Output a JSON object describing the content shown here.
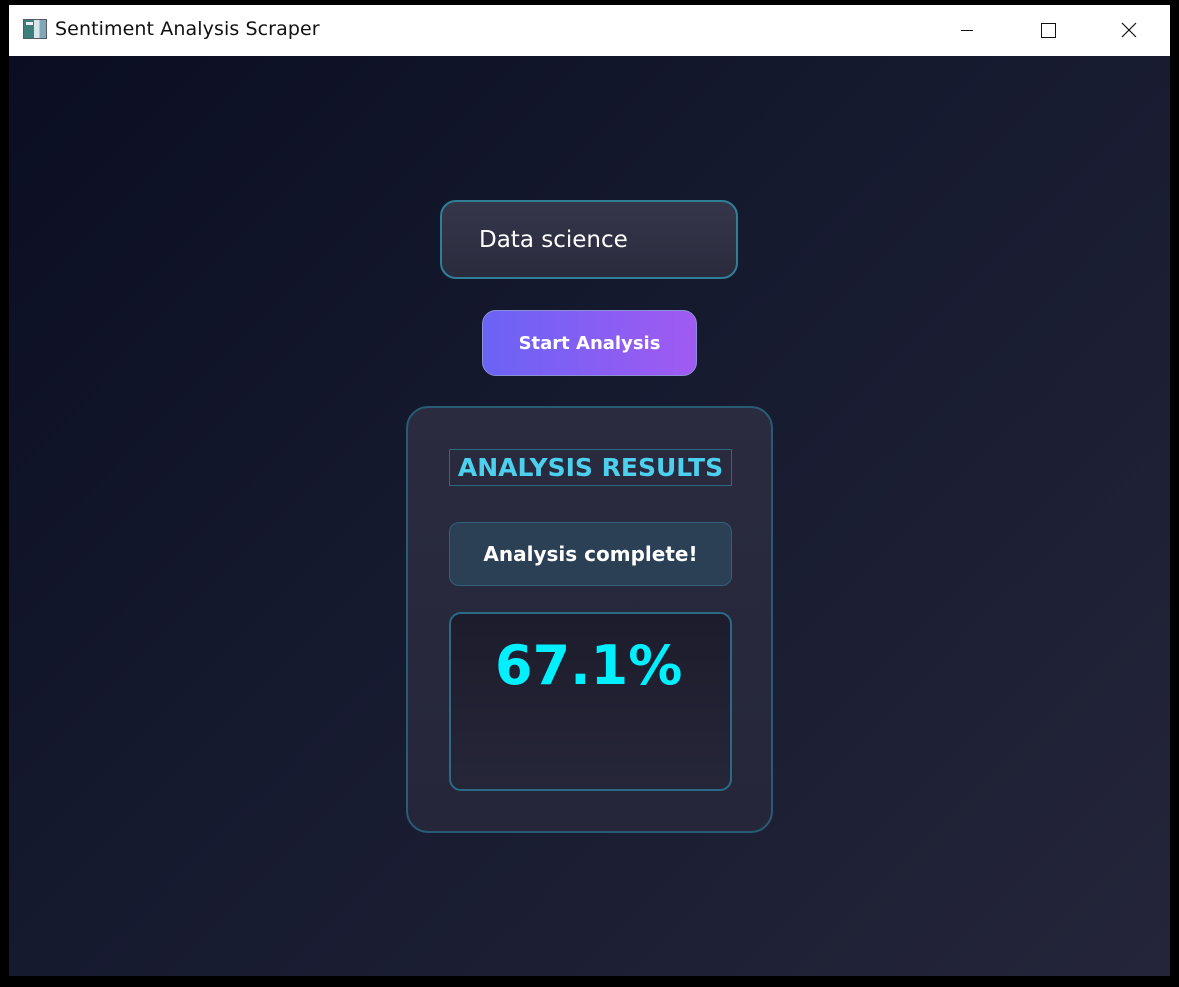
{
  "window": {
    "title": "Sentiment Analysis Scraper",
    "icon": "app-window-icon",
    "controls": {
      "minimize_icon": "minimize-icon",
      "maximize_icon": "maximize-icon",
      "close_icon": "close-icon"
    }
  },
  "search": {
    "value": "Data science"
  },
  "actions": {
    "start_label": "Start Analysis"
  },
  "results": {
    "heading": "ANALYSIS RESULTS",
    "status": "Analysis complete!",
    "score": "67.1%"
  },
  "colors": {
    "background_start": "#0b0e22",
    "background_end": "#24253a",
    "accent_cyan": "#00f0ff",
    "heading_cyan": "#4dd0ee",
    "button_start": "#6a63f5",
    "button_end": "#a15af2",
    "border_teal": "#2f7f96"
  }
}
